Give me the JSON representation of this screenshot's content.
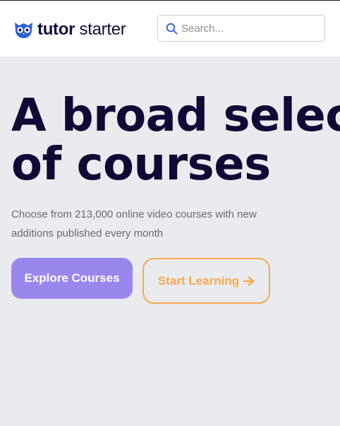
{
  "header": {
    "logo": {
      "bold_text": "tutor",
      "light_text": "starter",
      "icon": "owl-icon",
      "color": "#140f3a",
      "icon_color": "#2d5fd6"
    },
    "search": {
      "placeholder": "Search...",
      "value": "",
      "icon": "search-icon",
      "icon_color": "#2d5fd6"
    }
  },
  "hero": {
    "title_line1": "A broad selec",
    "title_line2": "of courses",
    "subtitle": "Choose from 213,000 online video courses with new additions published every month",
    "primary_button": {
      "label": "Explore Courses",
      "color": "#9a87ee"
    },
    "secondary_button": {
      "label": "Start Learning",
      "icon": "arrow-right-icon",
      "color": "#f8a94f"
    },
    "background": "#e9ebee",
    "title_color": "#0e0a35"
  }
}
